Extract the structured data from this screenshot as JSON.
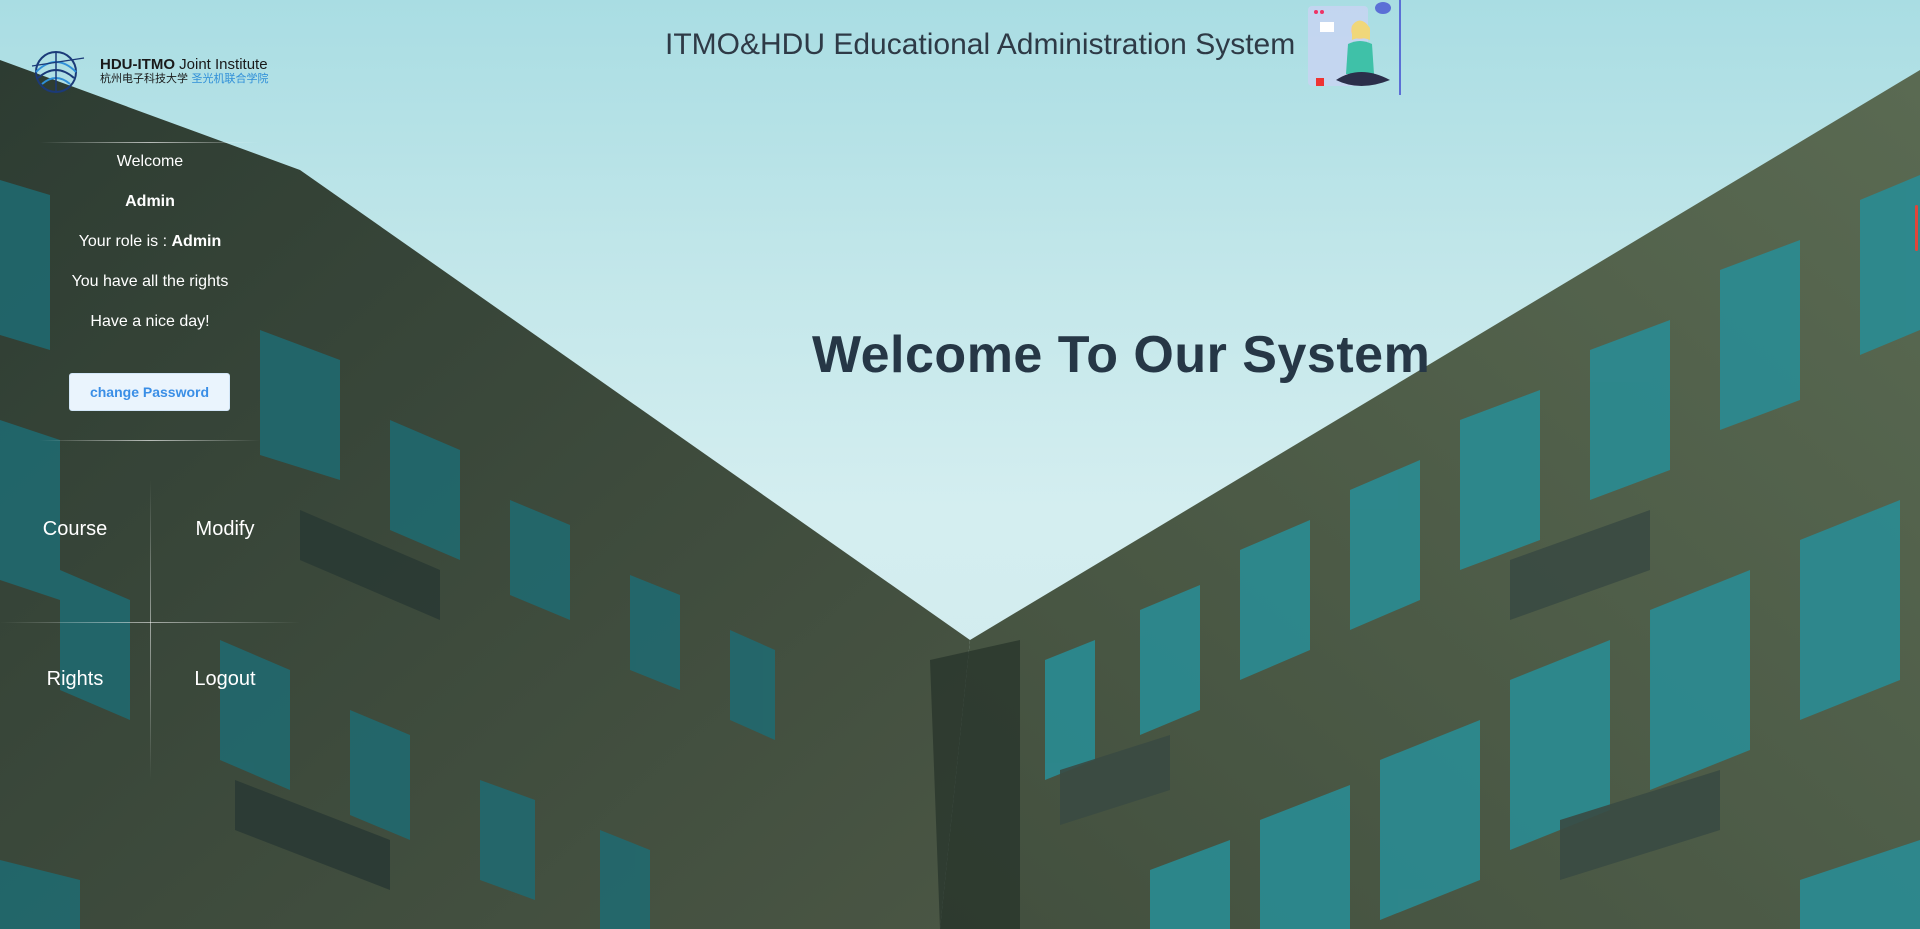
{
  "header": {
    "system_title": "ITMO&HDU Educational Administration System",
    "logo": {
      "name_bold": "HDU-ITMO",
      "name_rest": " Joint Institute",
      "cn_part1": "杭州电子科技大学 ",
      "cn_part2": "圣光机联合学院"
    }
  },
  "sidebar": {
    "welcome": "Welcome",
    "username": "Admin",
    "role_prefix": "Your role is : ",
    "role": "Admin",
    "rights_text": "You have all the rights",
    "greeting": "Have a nice day!",
    "change_password_label": "change Password",
    "menu": [
      {
        "label": "Course",
        "icon": "course-icon"
      },
      {
        "label": "Modify",
        "icon": "modify-icon"
      },
      {
        "label": "Rights",
        "icon": "rights-icon"
      },
      {
        "label": "Logout",
        "icon": "power-icon"
      }
    ]
  },
  "main": {
    "headline": "Welcome To Our System"
  },
  "colors": {
    "headline": "#263746",
    "button_text": "#3a8ee6",
    "sky": "#c3e7ea",
    "building": "#3f4f3d"
  }
}
